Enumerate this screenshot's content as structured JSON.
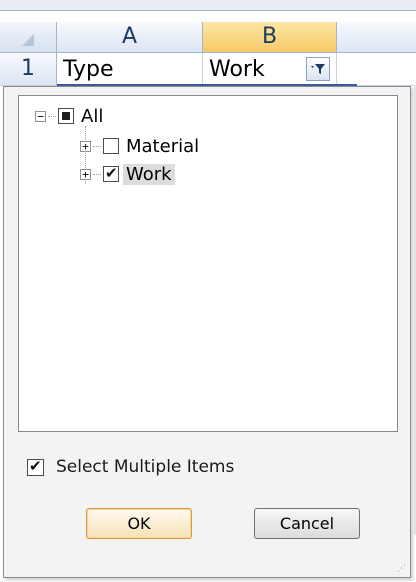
{
  "sheet": {
    "columns": [
      {
        "label": "A"
      },
      {
        "label": "B"
      }
    ],
    "rows": [
      {
        "number": "1",
        "cells": [
          "Type",
          "Work"
        ]
      }
    ],
    "filter_button_icon": "filter-dropdown-icon"
  },
  "filter_popup": {
    "tree": [
      {
        "label": "All",
        "state": "mixed",
        "expander": "−"
      },
      {
        "label": "Material",
        "state": "unchecked",
        "expander": "+"
      },
      {
        "label": "Work",
        "state": "checked",
        "expander": "+"
      }
    ],
    "select_multiple": {
      "label": "Select Multiple Items",
      "checked": true
    },
    "ok_label": "OK",
    "cancel_label": "Cancel"
  },
  "colors": {
    "selected_column_header": "#f6c868",
    "ok_border": "#d99a3c",
    "header_text": "#1b3a63"
  }
}
